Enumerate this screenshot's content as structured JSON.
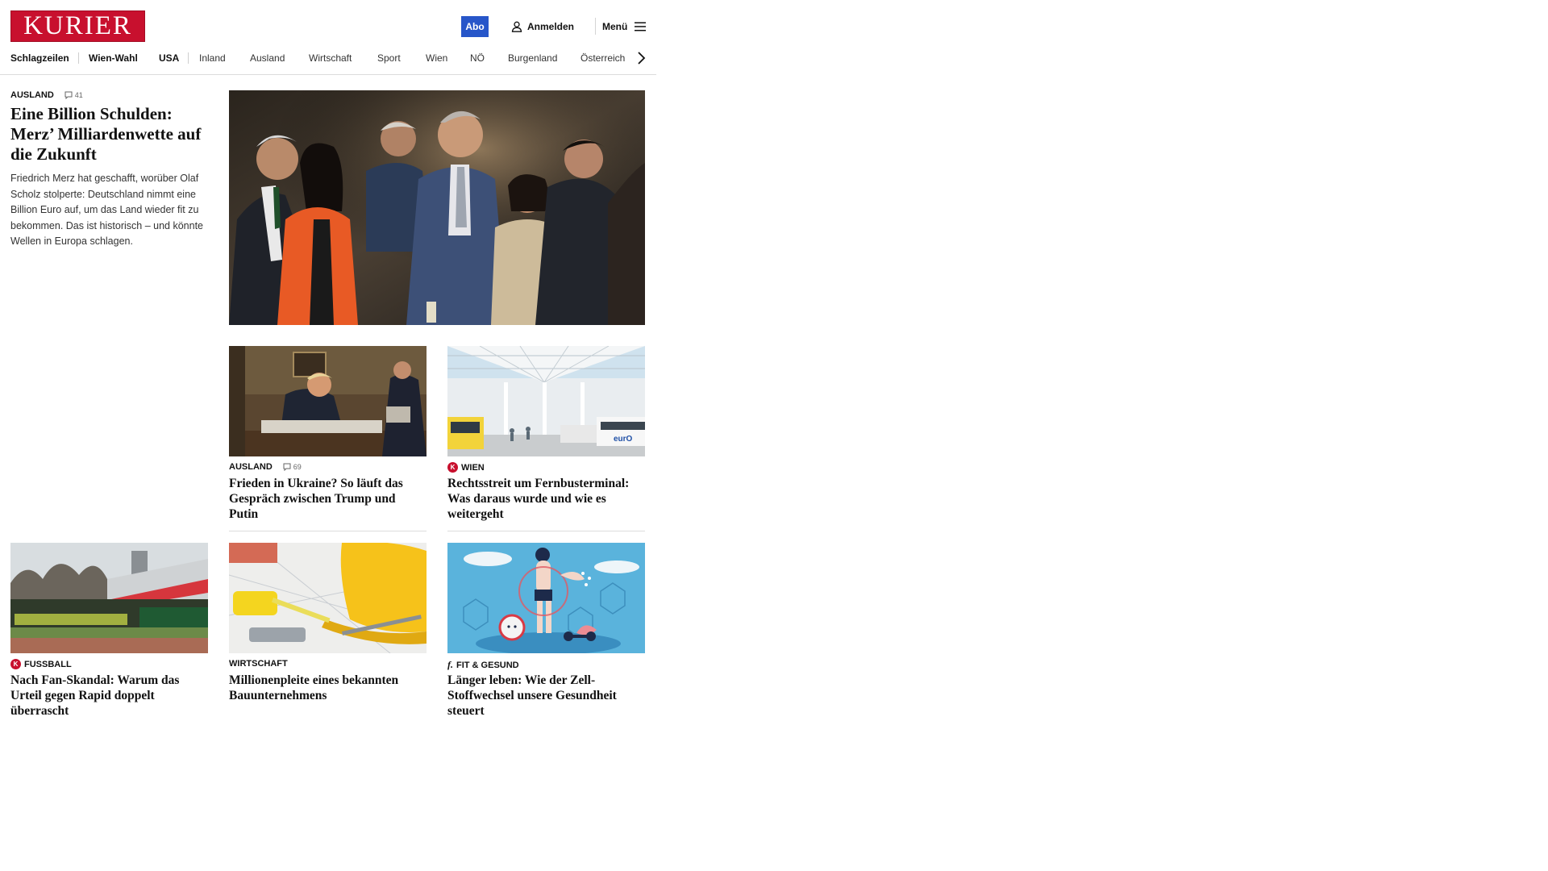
{
  "header": {
    "logo": "KURIER",
    "abo_label": "Abo",
    "login_label": "Anmelden",
    "menu_label": "Menü"
  },
  "nav": {
    "items": [
      "Schlagzeilen",
      "Wien-Wahl",
      "USA",
      "Inland",
      "Ausland",
      "Wirtschaft",
      "Sport",
      "Wien",
      "NÖ",
      "Burgenland",
      "Österreich"
    ]
  },
  "lead": {
    "section": "AUSLAND",
    "comments": "41",
    "headline": "Eine Billion Schulden: Merz’ Milliardenwette auf die Zukunft",
    "teaser": "Friedrich Merz hat geschafft, worüber Olaf Scholz stolperte: Deutschland nimmt eine Billion Euro auf, um das Land wieder fit zu bekommen. Das ist historisch – und könnte Wellen in Europa schlagen."
  },
  "cards": [
    {
      "section": "AUSLAND",
      "comments": "69",
      "headline": "Frieden in Ukraine? So läuft das Gespräch zwischen Trump und Putin"
    },
    {
      "section": "WIEN",
      "badge": "K",
      "headline": "Rechtsstreit um Fernbusterminal: Was daraus wurde und wie es weitergeht"
    },
    {
      "section": "FUSSBALL",
      "badge": "K",
      "headline": "Nach Fan-Skandal: Warum das Urteil gegen Rapid doppelt überrascht"
    },
    {
      "section": "WIRTSCHAFT",
      "headline": "Millionenpleite eines bekannten Bauunternehmens"
    },
    {
      "section": "FIT & GESUND",
      "badge": "f.",
      "headline": "Länger leben: Wie der Zell-Stoffwechsel unsere Gesundheit steuert"
    }
  ],
  "images": {
    "bus_label": "eurO"
  },
  "colors": {
    "brand": "#c8102e",
    "abo": "#2756c9"
  }
}
